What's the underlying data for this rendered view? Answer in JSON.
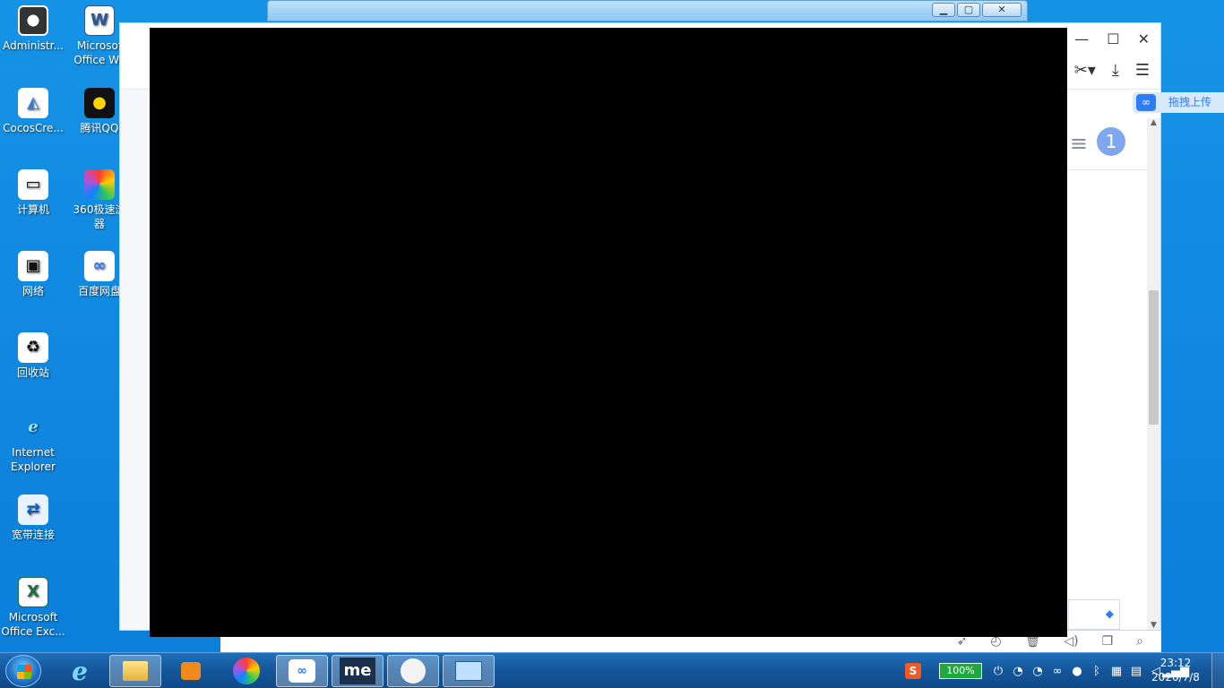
{
  "desktop_icons": [
    {
      "label": "Administr...",
      "icon": "user-account-icon"
    },
    {
      "label": "Microsoft Office Wo...",
      "label_l1": "Microsof",
      "label_l2": "Office Wo",
      "icon": "word-icon"
    },
    {
      "label": "CocosCre...",
      "icon": "cocos-creator-icon"
    },
    {
      "label": "腾讯QQ",
      "icon": "qq-icon"
    },
    {
      "label": "计算机",
      "icon": "computer-icon"
    },
    {
      "label_l1": "360极速浏",
      "label_l2": "器",
      "icon": "browser-360-icon"
    },
    {
      "label": "网络",
      "icon": "network-icon"
    },
    {
      "label": "百度网盘",
      "icon": "baidu-netdisk-icon"
    },
    {
      "label": "回收站",
      "icon": "recycle-bin-icon"
    },
    {
      "label_l1": "Internet",
      "label_l2": "Explorer",
      "icon": "ie-icon"
    },
    {
      "label": "宽带连接",
      "icon": "broadband-icon"
    },
    {
      "label_l1": "Microsoft",
      "label_l2": "Office Exc...",
      "icon": "excel-icon"
    }
  ],
  "baidu": {
    "upload_label": "拖拽上传",
    "badge_count": "1"
  },
  "taskbar": {
    "battery": "100%",
    "time": "23:12",
    "date": "2020/7/8",
    "me_label": "me"
  },
  "colors": {
    "desktop": "#1593e6",
    "taskbar": "#14569a",
    "accent": "#2e7cf6",
    "overlay": "#000000"
  }
}
